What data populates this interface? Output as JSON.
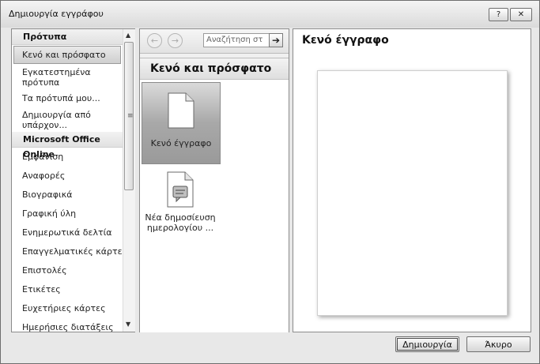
{
  "window": {
    "title": "Δημιουργία εγγράφου",
    "help_label": "?",
    "close_label": "✕"
  },
  "sidebar": {
    "section_templates": "Πρότυπα",
    "items": [
      {
        "label": "Κενό και πρόσφατο",
        "selected": true
      },
      {
        "label": "Εγκατεστημένα πρότυπα"
      },
      {
        "label": "Τα πρότυπά μου..."
      },
      {
        "label": "Δημιουργία από υπάρχον..."
      }
    ],
    "section_online": "Microsoft Office Online",
    "online_items": [
      "Εμφάνιση",
      "Αναφορές",
      "Βιογραφικά",
      "Γραφική ύλη",
      "Ενημερωτικά δελτία",
      "Επαγγελματικές κάρτες",
      "Επιστολές",
      "Ετικέτες",
      "Ευχετήριες κάρτες",
      "Ημερήσιες διατάξεις"
    ]
  },
  "middle": {
    "search_placeholder": "Αναζήτηση στ",
    "heading": "Κενό και πρόσφατο",
    "tiles": [
      {
        "label": "Κενό έγγραφο",
        "icon": "blank-document-icon",
        "selected": true
      },
      {
        "label": "Νέα δημοσίευση ημερολογίου ...",
        "icon": "blog-post-icon"
      }
    ]
  },
  "preview": {
    "title": "Κενό έγγραφο"
  },
  "buttons": {
    "create": "Δημιουργία",
    "cancel": "Άκυρο"
  }
}
